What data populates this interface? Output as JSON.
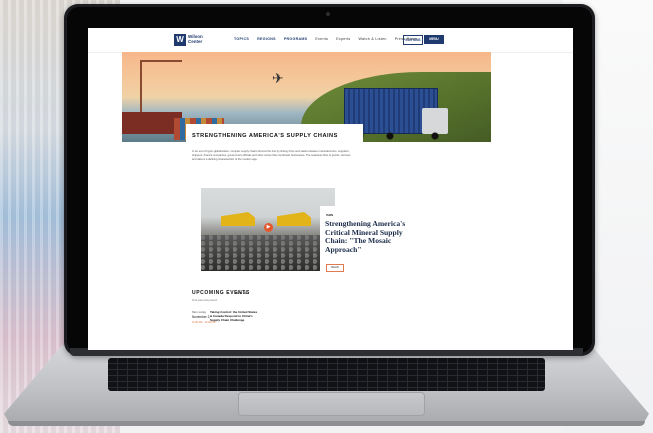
{
  "site": {
    "logo_mark": "W",
    "logo_text": "Wilson Center",
    "nav": [
      "TOPICS",
      "REGIONS",
      "PROGRAMS",
      "Events",
      "Experts",
      "Watch & Listen",
      "Press Room"
    ],
    "editions_label": "EDITIONS",
    "menu_label": "MENU"
  },
  "page": {
    "title": "STRENGTHENING AMERICA'S SUPPLY CHAINS",
    "intro": "In an era of hyper-globalization, complex supply chains blurred the line by linking firms and states between manufacturers, suppliers, shippers, finance companies, government officials and other actors that coordinate businesses. The seamless flow of goods, services and data is a defining characteristic of the modern age."
  },
  "feature": {
    "tag": "ISBN",
    "title": "Strengthening America's Critical Mineral Supply Chain: \"The Mosaic Approach\"",
    "button": "READ",
    "play_icon": "play-icon"
  },
  "events": {
    "heading": "UPCOMING EVENTS",
    "view_all": "View All",
    "subheading": "Find past and present",
    "items": [
      {
        "date_line1": "Mon today",
        "date_line2": "November 2,",
        "time": "11:00 AM - 12:00 PM",
        "title": "Taking Control: the United States & Canada Respond to China's Supply Chain Challenge"
      }
    ]
  }
}
